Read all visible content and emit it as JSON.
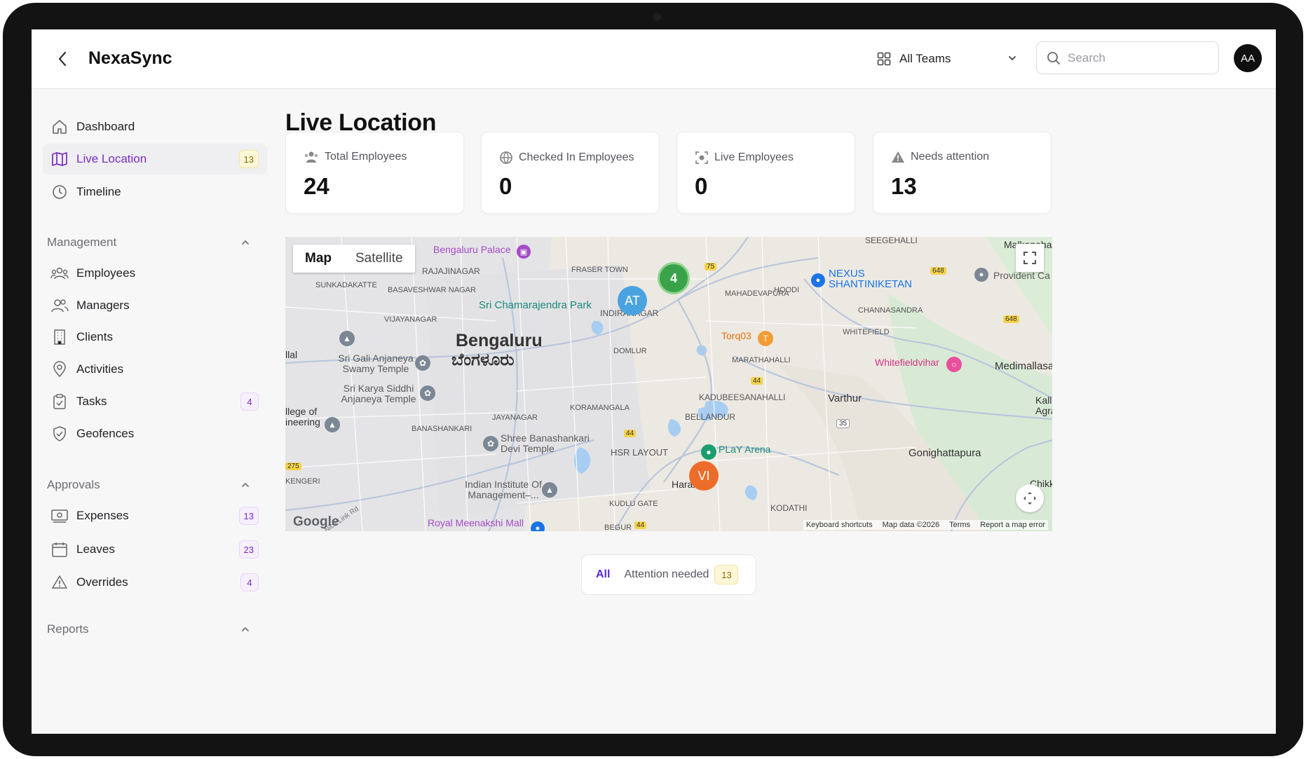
{
  "header": {
    "app_title": "NexaSync",
    "team_select": {
      "selected": "All Teams"
    },
    "search": {
      "placeholder": "Search"
    },
    "avatar_initials": "AA"
  },
  "sidebar": {
    "items": [
      {
        "label": "Dashboard",
        "icon": "home-icon"
      },
      {
        "label": "Live Location",
        "icon": "map-icon",
        "badge": "13",
        "active": true
      },
      {
        "label": "Timeline",
        "icon": "clock-icon"
      }
    ],
    "sections": [
      {
        "title": "Management",
        "items": [
          {
            "label": "Employees",
            "icon": "users-icon"
          },
          {
            "label": "Managers",
            "icon": "user-group-icon"
          },
          {
            "label": "Clients",
            "icon": "building-icon"
          },
          {
            "label": "Activities",
            "icon": "location-pin-icon"
          },
          {
            "label": "Tasks",
            "icon": "clipboard-icon",
            "badge": "4"
          },
          {
            "label": "Geofences",
            "icon": "shield-check-icon"
          }
        ]
      },
      {
        "title": "Approvals",
        "items": [
          {
            "label": "Expenses",
            "icon": "banknote-icon",
            "badge": "13"
          },
          {
            "label": "Leaves",
            "icon": "calendar-icon",
            "badge": "23"
          },
          {
            "label": "Overrides",
            "icon": "warning-icon",
            "badge": "4"
          }
        ]
      },
      {
        "title": "Reports"
      }
    ]
  },
  "main": {
    "page_title": "Live Location",
    "stats": [
      {
        "label": "Total Employees",
        "value": "24",
        "icon": "users-icon"
      },
      {
        "label": "Checked In Employees",
        "value": "0",
        "icon": "globe-icon"
      },
      {
        "label": "Live Employees",
        "value": "0",
        "icon": "live-target-icon"
      },
      {
        "label": "Needs attention",
        "value": "13",
        "icon": "warning-icon"
      }
    ],
    "map": {
      "type_options": [
        "Map",
        "Satellite"
      ],
      "selected_type": "Map",
      "city_label": "Bengaluru",
      "city_label_local": "ಬೆಂಗಳೂರು",
      "markers": [
        {
          "label": "4",
          "color": "#3aa34a"
        },
        {
          "label": "AT",
          "color": "#4aa3e0"
        },
        {
          "label": "VI",
          "color": "#ee6c2a"
        }
      ],
      "places": {
        "bengaluru_palace": "Bengaluru Palace",
        "rajajinagar": "RAJAJINAGAR",
        "sunkadakatte": "SUNKADAKATTE",
        "basaveshwar_nagar": "BASAVESHWAR NAGAR",
        "fraser_town": "FRASER TOWN",
        "sri_chamarajendra_park": "Sri Chamarajendra Park",
        "indiranagar": "INDIRANAGAR",
        "vijayanagar": "VIJAYANAGAR",
        "seegehalli": "SEEGEHALLI",
        "nexus_shantiniketan": "NEXUS SHANTINIKETAN",
        "mahadevapura": "MAHADEVAPURA",
        "hoodi": "HOODI",
        "channasandra": "CHANNASANDRA",
        "provident": "Provident Ca",
        "whitefield": "WHITEFIELD",
        "torq03": "Torq03",
        "whitefieldvihar": "Whitefieldvihar",
        "medimallasa": "Medimallasa",
        "domlur": "DOMLUR",
        "marathahalli": "MARATHAHALLI",
        "sri_gali_anjaneya": "Sri Gali Anjaneya Swamy Temple",
        "sri_karya_siddhi": "Sri Karya Siddhi Anjaneya Temple",
        "kadubeesanahalli": "KADUBEESANAHALLI",
        "bellandur": "BELLANDUR",
        "varthur": "Varthur",
        "koramangala": "KORAMANGALA",
        "jayanagar": "JAYANAGAR",
        "banashankari": "BANASHANKARI",
        "shree_banashankari": "Shree Banashankari Devi Temple",
        "hsr_layout": "HSR LAYOUT",
        "play_arena": "PLaY Arena",
        "gonighattapura": "Gonighattapura",
        "haralur": "Haralur",
        "iim": "Indian Institute Of Management–...",
        "royal_meenakshi": "Royal Meenakshi Mall",
        "kudlu_gate": "KUDLU GATE",
        "begur": "BEGUR",
        "kodathi": "KODATHI",
        "college": "llege of ineering",
        "kengeri": "KENGERI",
        "illal": "llal",
        "kalli": "Kall Agra",
        "chikk": "Chikk",
        "malkanaha": "Malkanaha",
        "nice_link_rd": "Nice Link Rd"
      },
      "road_shields": [
        "75",
        "648",
        "648",
        "44",
        "44",
        "44",
        "35",
        "275",
        "648"
      ],
      "google_label": "Google",
      "attribution": [
        "Keyboard shortcuts",
        "Map data ©2026",
        "Terms",
        "Report a map error"
      ]
    },
    "filter": {
      "all_label": "All",
      "attention_label": "Attention needed",
      "attention_count": "13"
    }
  },
  "colors": {
    "accent_purple": "#7a2bc2",
    "filter_blue": "#5b2bd6",
    "badge_yellow_bg": "#fdf6d8",
    "marker_green": "#3aa34a",
    "marker_blue": "#4aa3e0",
    "marker_orange": "#ee6c2a"
  }
}
